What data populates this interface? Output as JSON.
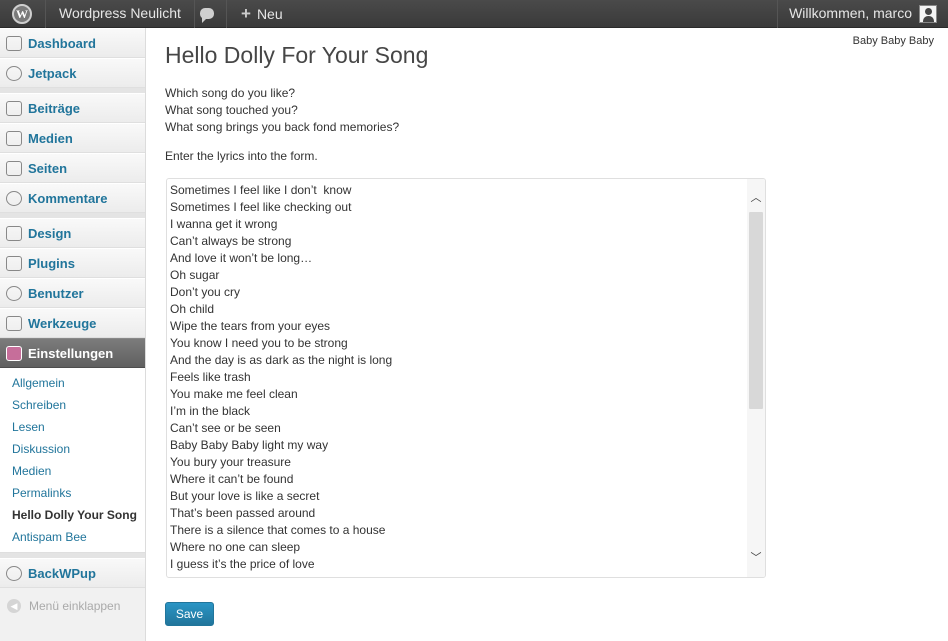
{
  "adminbar": {
    "site_name": "Wordpress Neulicht",
    "new_label": "Neu",
    "greeting": "Willkommen, marco"
  },
  "sidebar": {
    "items": [
      {
        "label": "Dashboard",
        "icon": "dashboard-icon"
      },
      {
        "label": "Jetpack",
        "icon": "jetpack-icon"
      },
      {
        "label": "Beiträge",
        "icon": "pin-icon"
      },
      {
        "label": "Medien",
        "icon": "media-icon"
      },
      {
        "label": "Seiten",
        "icon": "pages-icon"
      },
      {
        "label": "Kommentare",
        "icon": "comments-icon"
      },
      {
        "label": "Design",
        "icon": "design-icon"
      },
      {
        "label": "Plugins",
        "icon": "plugins-icon"
      },
      {
        "label": "Benutzer",
        "icon": "users-icon"
      },
      {
        "label": "Werkzeuge",
        "icon": "tools-icon"
      },
      {
        "label": "Einstellungen",
        "icon": "settings-icon"
      },
      {
        "label": "BackWPup",
        "icon": "backwpup-icon"
      }
    ],
    "submenu": [
      "Allgemein",
      "Schreiben",
      "Lesen",
      "Diskussion",
      "Medien",
      "Permalinks",
      "Hello Dolly Your Song",
      "Antispam Bee"
    ],
    "collapse_label": "Menü einklappen"
  },
  "main": {
    "dolly_line": "Baby Baby Baby",
    "title": "Hello Dolly For Your Song",
    "questions": [
      "Which song do you like?",
      "What song touched you?",
      "What song brings you back fond memories?"
    ],
    "instruction": "Enter the lyrics into the form.",
    "lyrics": [
      "Sometimes I feel like I don’t  know",
      "Sometimes I feel like checking out",
      "I wanna get it wrong",
      "Can’t always be strong",
      "And love it won’t be long…",
      "Oh sugar",
      "Don’t you cry",
      "Oh child",
      "Wipe the tears from your eyes",
      "You know I need you to be strong",
      "And the day is as dark as the night is long",
      "Feels like trash",
      "You make me feel clean",
      "I’m in the black",
      "Can’t see or be seen",
      "Baby Baby Baby light my way",
      "You bury your treasure",
      "Where it can’t be found",
      "But your love is like a secret",
      "That’s been passed around",
      "There is a silence that comes to a house",
      "Where no one can sleep",
      "I guess it’s the price of love"
    ],
    "save_label": "Save"
  },
  "colors": {
    "accent": "#21759b",
    "adminbar": "#464646",
    "current_menu": "#6d6d6d"
  }
}
